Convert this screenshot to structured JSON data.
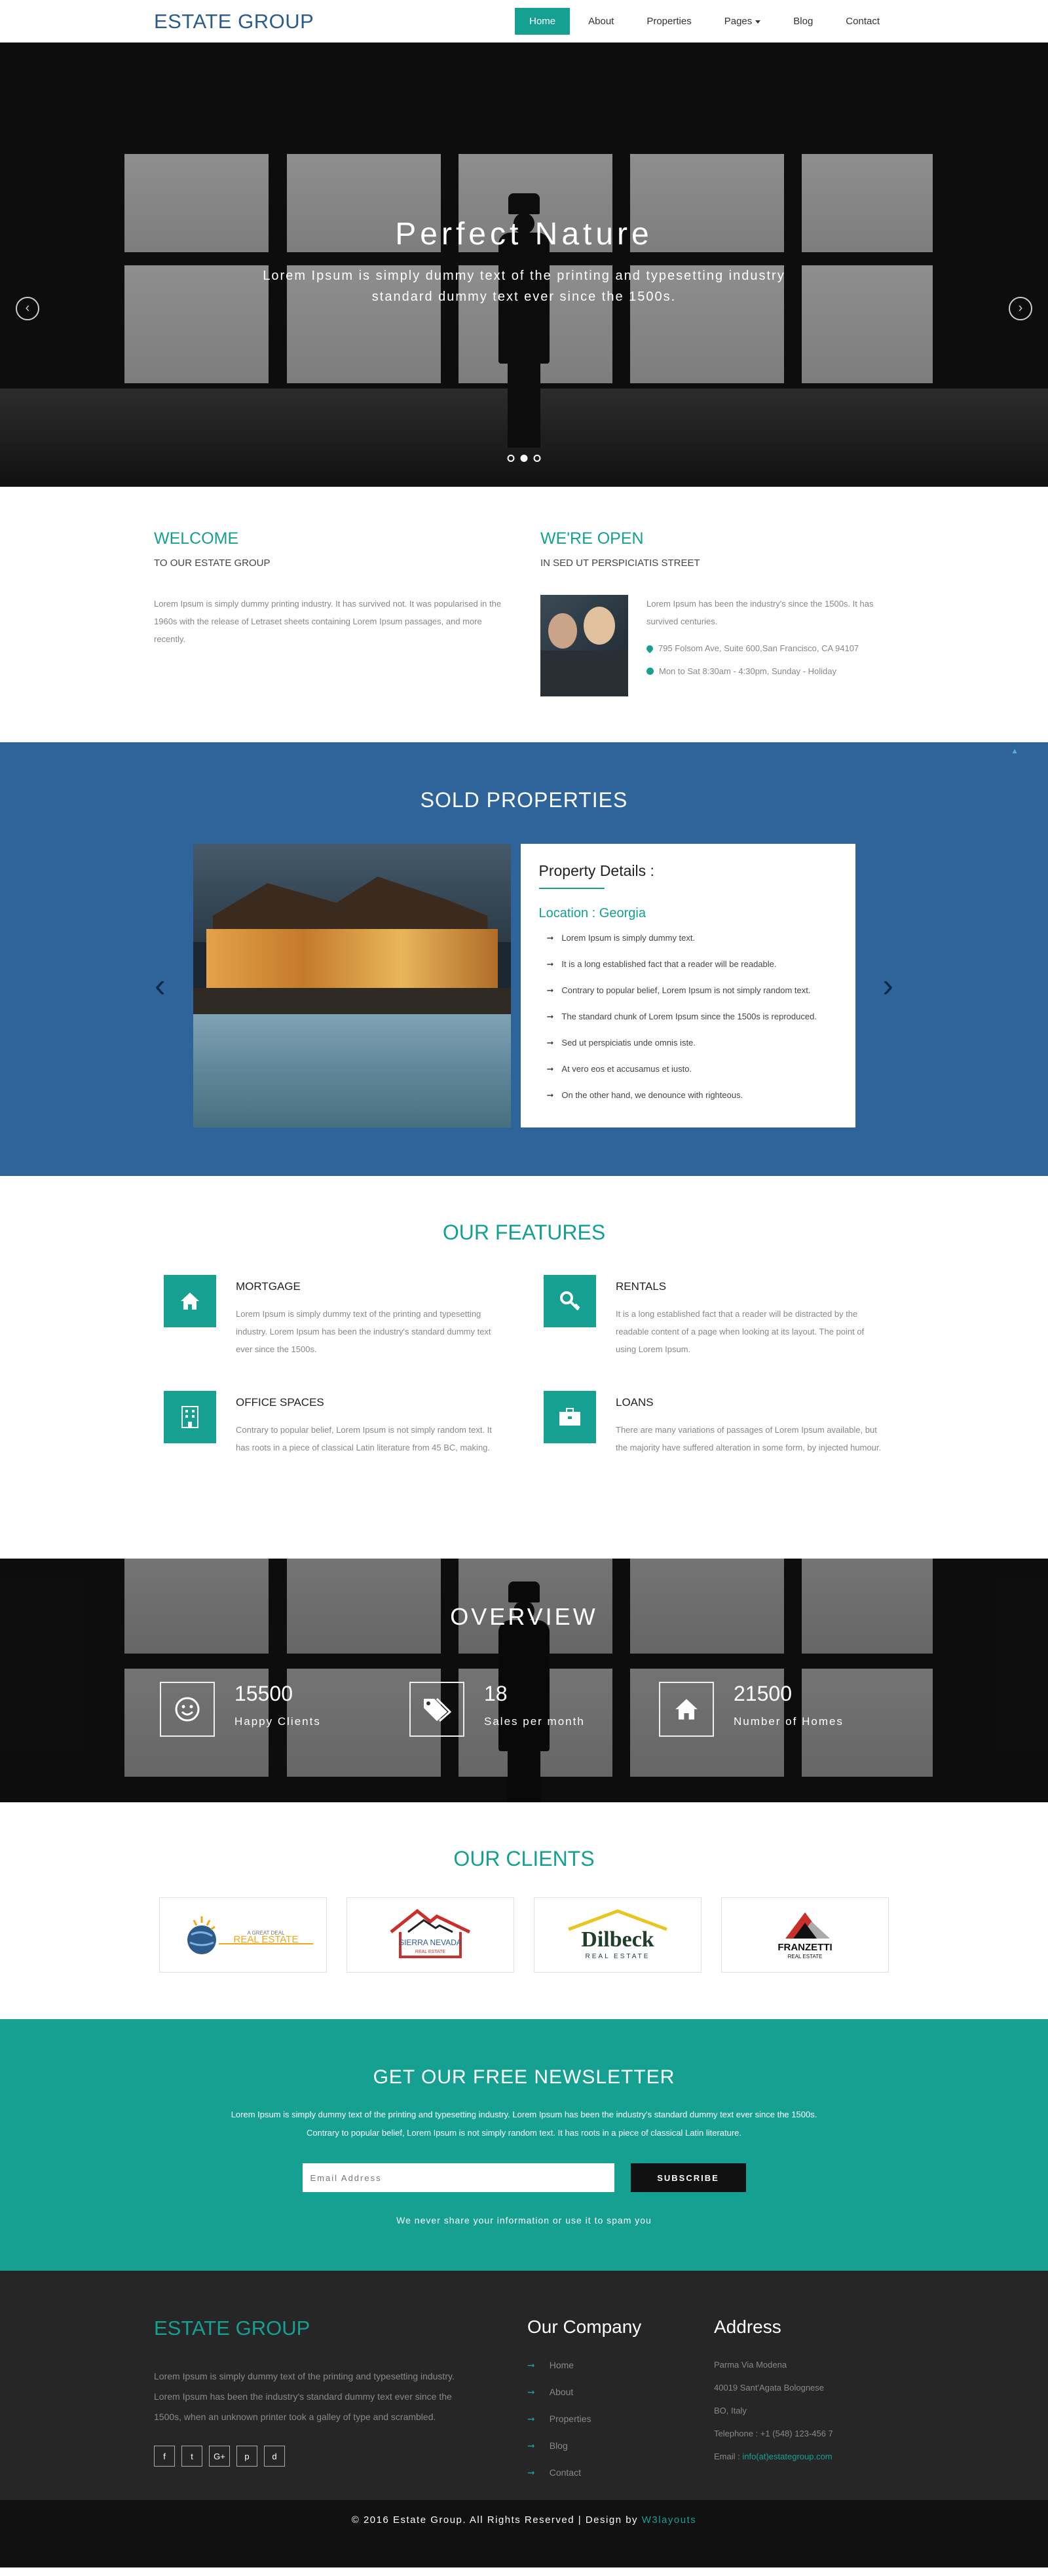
{
  "brand": "ESTATE GROUP",
  "nav": {
    "items": [
      {
        "label": "Home",
        "active": true
      },
      {
        "label": "About"
      },
      {
        "label": "Properties"
      },
      {
        "label": "Pages",
        "dropdown": true
      },
      {
        "label": "Blog"
      },
      {
        "label": "Contact"
      }
    ]
  },
  "hero": {
    "title": "Perfect Nature",
    "subtitle": "Lorem Ipsum is simply dummy text of the printing and typesetting industry standard dummy text ever since the 1500s.",
    "prev_icon": "chevron-left-icon",
    "next_icon": "chevron-right-icon",
    "slides": 3,
    "active_slide": 2
  },
  "welcome": {
    "title": "WELCOME",
    "subtitle": "TO OUR ESTATE GROUP",
    "text": "Lorem Ipsum is simply dummy printing industry. It has survived not. It was popularised in the 1960s with the release of Letraset sheets containing Lorem Ipsum passages, and more recently."
  },
  "open": {
    "title": "WE'RE OPEN",
    "subtitle": "IN SED UT PERSPICIATIS STREET",
    "text": "Lorem Ipsum has been the industry's since the 1500s. It has survived centuries.",
    "address": "795 Folsom Ave, Suite 600,San Francisco, CA 94107",
    "hours": "Mon to Sat 8:30am - 4:30pm, Sunday - Holiday"
  },
  "sold": {
    "title": "SOLD PROPERTIES",
    "card_title": "Property Details :",
    "location_label": "Location : ",
    "location": "Georgia",
    "items": [
      "Lorem Ipsum is simply dummy text.",
      "It is a long established fact that a reader will be readable.",
      "Contrary to popular belief, Lorem Ipsum is not simply random text.",
      "The standard chunk of Lorem Ipsum since the 1500s is reproduced.",
      "Sed ut perspiciatis unde omnis iste.",
      "At vero eos et accusamus et iusto.",
      "On the other hand, we denounce with righteous."
    ]
  },
  "features": {
    "title": "OUR FEATURES",
    "items": [
      {
        "title": "MORTGAGE",
        "icon": "home-icon",
        "text": "Lorem Ipsum is simply dummy text of the printing and typesetting industry. Lorem Ipsum has been the industry's standard dummy text ever since the 1500s."
      },
      {
        "title": "RENTALS",
        "icon": "key-icon",
        "text": "It is a long established fact that a reader will be distracted by the readable content of a page when looking at its layout. The point of using Lorem Ipsum."
      },
      {
        "title": "OFFICE SPACES",
        "icon": "building-icon",
        "text": "Contrary to popular belief, Lorem Ipsum is not simply random text. It has roots in a piece of classical Latin literature from 45 BC, making."
      },
      {
        "title": "LOANS",
        "icon": "briefcase-icon",
        "text": "There are many variations of passages of Lorem Ipsum available, but the majority have suffered alteration in some form, by injected humour."
      }
    ]
  },
  "overview": {
    "title": "OVERVIEW",
    "stats": [
      {
        "num": "15500",
        "label": "Happy Clients",
        "icon": "smile-icon"
      },
      {
        "num": "18",
        "label": "Sales per month",
        "icon": "tags-icon"
      },
      {
        "num": "21500",
        "label": "Number of Homes",
        "icon": "home-icon"
      }
    ]
  },
  "clients": {
    "title": "OUR CLIENTS",
    "logos": [
      {
        "name": "REAL ESTATE",
        "tag": "A GREAT DEAL"
      },
      {
        "name": "SIERRA NEVADA",
        "tag": "REAL ESTATE"
      },
      {
        "name": "Dilbeck",
        "tag": "REAL ESTATE"
      },
      {
        "name": "FRANZETTI",
        "tag": "REAL ESTATE"
      }
    ]
  },
  "newsletter": {
    "title": "GET OUR FREE NEWSLETTER",
    "text": "Lorem Ipsum is simply dummy text of the printing and typesetting industry. Lorem Ipsum has been the industry's standard dummy text ever since the 1500s. Contrary to popular belief, Lorem Ipsum is not simply random text. It has roots in a piece of classical Latin literature.",
    "placeholder": "Email Address",
    "button": "SUBSCRIBE",
    "note": "We never share your information or use it to spam you"
  },
  "footer": {
    "logo": "ESTATE GROUP",
    "text": "Lorem Ipsum is simply dummy text of the printing and typesetting industry. Lorem Ipsum has been the industry's standard dummy text ever since the 1500s, when an unknown printer took a galley of type and scrambled.",
    "socials": [
      "f",
      "t",
      "G+",
      "p",
      "d"
    ],
    "company_title": "Our Company",
    "links": [
      "Home",
      "About",
      "Properties",
      "Blog",
      "Contact"
    ],
    "address_title": "Address",
    "address": [
      "Parma Via Modena",
      "40019 Sant'Agata Bolognese",
      "BO, Italy",
      "Telephone : +1 (548) 123-456 7"
    ],
    "email_label": "Email : ",
    "email": "info(at)estategroup.com"
  },
  "copyright": {
    "text": "© 2016 Estate Group. All Rights Reserved | Design by ",
    "credit": "W3layouts"
  },
  "colors": {
    "teal": "#15a092",
    "blue": "#2e6499",
    "dark": "#262626",
    "brand_blue": "#2d5b8c"
  }
}
